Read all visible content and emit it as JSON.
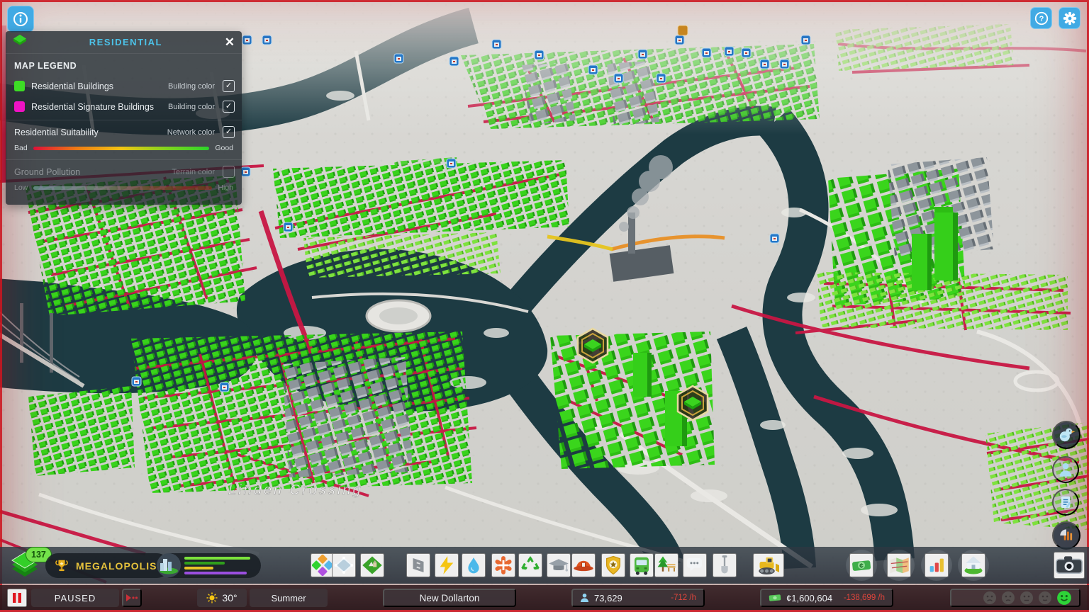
{
  "top_bar": {
    "icons": [
      "info-icon",
      "help-icon",
      "settings-gear-icon"
    ]
  },
  "legend": {
    "title": "RESIDENTIAL",
    "close_glyph": "✕",
    "section_title": "MAP LEGEND",
    "rows": [
      {
        "label": "Residential Buildings",
        "color_type": "Building color",
        "check": "✓",
        "swatch": "#3ddc25"
      },
      {
        "label": "Residential Signature Buildings",
        "color_type": "Building color",
        "check": "✓",
        "swatch": "#ef12c3"
      }
    ],
    "suitability": {
      "label": "Residential Suitability",
      "color_type": "Network color",
      "check": "✓",
      "low_label": "Bad",
      "high_label": "Good",
      "gradient": [
        "#dd1038",
        "#ee7c14",
        "#f2c413",
        "#84d41d",
        "#2bd32b"
      ]
    },
    "pollution": {
      "label": "Ground Pollution",
      "color_type": "Terrain color",
      "check": "",
      "low_label": "Low",
      "high_label": "High",
      "gradient": [
        "#a9cfe6",
        "#b8bcba",
        "#bf4a32",
        "#c02315"
      ]
    }
  },
  "map": {
    "district_label": "Linden Crossing"
  },
  "side_buttons": {
    "icons": [
      "chirper-bird-icon",
      "citizen-icon",
      "journal-icon",
      "radio-icon"
    ]
  },
  "toolbar": {
    "xp_badge": "137",
    "milestone_label": "MEGALOPOLIS",
    "progress_bars": [
      {
        "color": "#7ce33c",
        "percent": 95
      },
      {
        "color": "#2f9e1c",
        "percent": 58
      },
      {
        "color": "#e8c428",
        "percent": 42
      },
      {
        "color": "#9b4fe0",
        "percent": 90
      }
    ],
    "tools": [
      "zoning",
      "areas",
      "landscaping",
      "roads",
      "electricity",
      "water-sewage",
      "healthcare",
      "garbage",
      "education",
      "fire-rescue",
      "police",
      "transportation",
      "parks-recreation",
      "communications",
      "terraforming",
      "bulldozer",
      "economy",
      "info-views",
      "statistics",
      "city-information",
      "photo-mode"
    ]
  },
  "status_bar": {
    "sim_state": "PAUSED",
    "temperature": "30°",
    "season": "Summer",
    "city_name": "New Dollarton",
    "population": "73,629",
    "population_rate": "-712 /h",
    "money": "¢1,600,604",
    "money_rate": "-138,699 /h"
  },
  "colors": {
    "accent_blue": "#41aae4",
    "alert_red": "#e0453c",
    "money_green": "#58c85a",
    "happiness_green": "#2ed338",
    "road_red": "#c81744",
    "water_teal": "#1d3b43"
  }
}
